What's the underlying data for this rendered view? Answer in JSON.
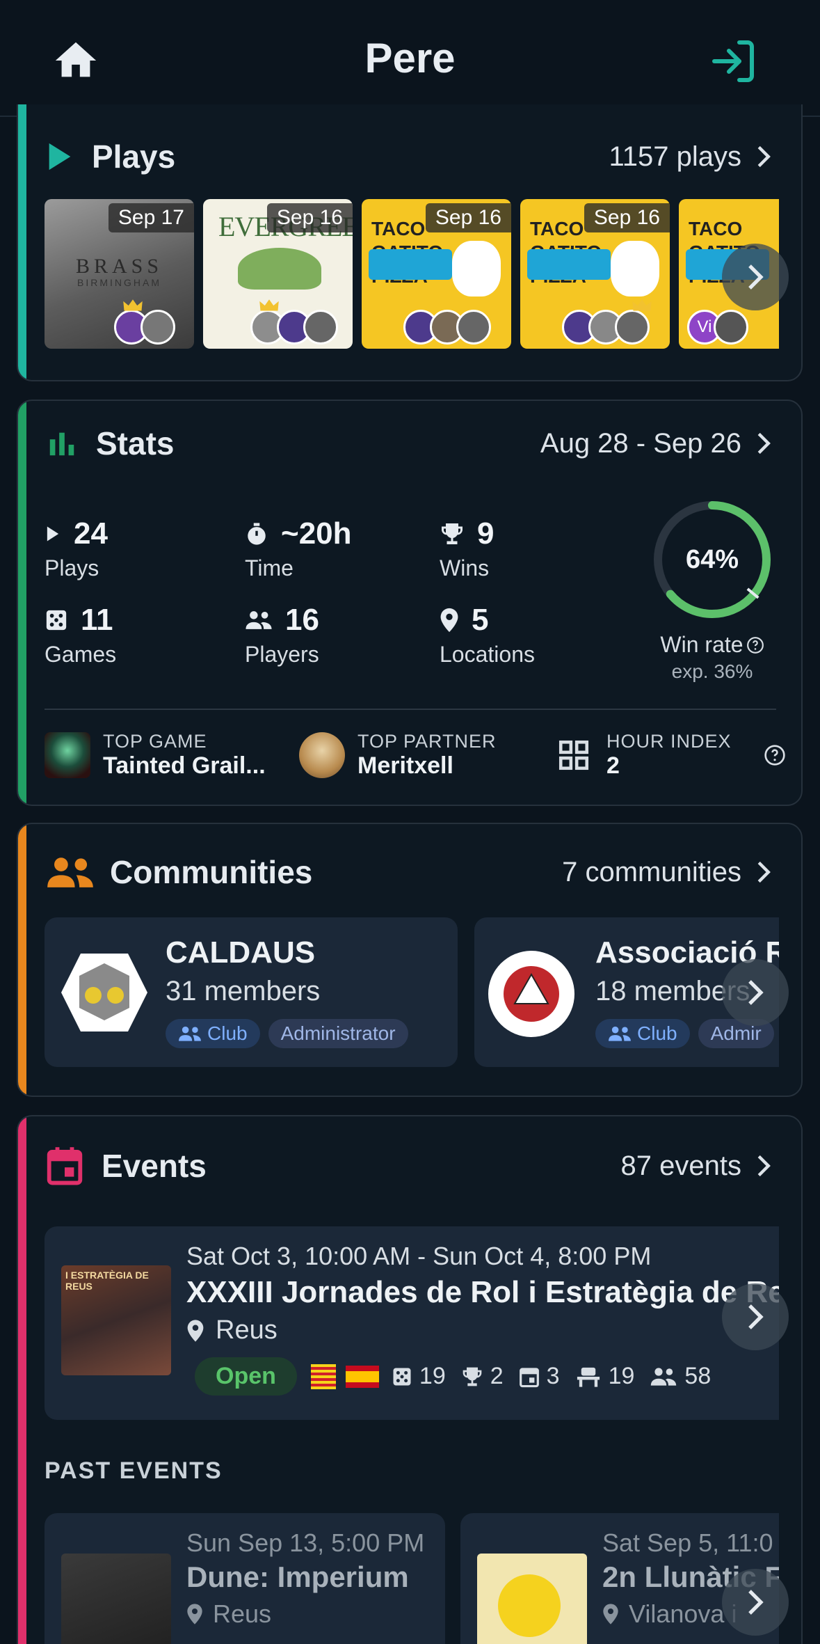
{
  "header": {
    "title": "Pere",
    "left_icon": "home-icon",
    "right_icon": "login-icon"
  },
  "plays": {
    "title": "Plays",
    "count_label": "1157 plays",
    "items": [
      {
        "date": "Sep 17",
        "game": "BRASS",
        "subtitle": "BIRMINGHAM"
      },
      {
        "date": "Sep 16",
        "game": "EVERGREEN"
      },
      {
        "date": "Sep 16",
        "game": "TACO GATITO PIZZA"
      },
      {
        "date": "Sep 16",
        "game": "TACO GATITO PIZZA"
      },
      {
        "date": "Se",
        "game": "TACO GATITO PIZZA",
        "avatar_initials": "Vi"
      }
    ]
  },
  "stats": {
    "title": "Stats",
    "range_label": "Aug 28 - Sep 26",
    "plays": {
      "value": "24",
      "label": "Plays"
    },
    "time": {
      "value": "~20h",
      "label": "Time"
    },
    "wins": {
      "value": "9",
      "label": "Wins"
    },
    "games": {
      "value": "11",
      "label": "Games"
    },
    "players": {
      "value": "16",
      "label": "Players"
    },
    "locations": {
      "value": "5",
      "label": "Locations"
    },
    "win_rate": {
      "percent_label": "64%",
      "fraction": 0.64,
      "expected_fraction": 0.36,
      "label": "Win rate",
      "expected_label": "exp. 36%"
    },
    "top_game": {
      "caption": "TOP GAME",
      "value": "Tainted Grail..."
    },
    "top_partner": {
      "caption": "TOP PARTNER",
      "value": "Meritxell"
    },
    "hour_index": {
      "caption": "HOUR INDEX",
      "value": "2"
    }
  },
  "communities": {
    "title": "Communities",
    "count_label": "7 communities",
    "items": [
      {
        "name": "CALDAUS",
        "members": "31 members",
        "badge_type": "Club",
        "badge_role": "Administrator"
      },
      {
        "name": "Associació R",
        "members": "18 members",
        "badge_type": "Club",
        "badge_role": "Admir"
      }
    ]
  },
  "events": {
    "title": "Events",
    "count_label": "87 events",
    "featured": {
      "datetime": "Sat Oct 3, 10:00 AM - Sun Oct 4, 8:00 PM",
      "name": "XXXIII Jornades de Rol i Estratègia de Reus",
      "location": "Reus",
      "status": "Open",
      "games": "19",
      "tournaments": "2",
      "days": "3",
      "tables": "19",
      "attendees": "58",
      "poster_text": "I ESTRATÈGIA DE REUS"
    },
    "past_title": "PAST EVENTS",
    "past": [
      {
        "datetime": "Sun Sep 13, 5:00 PM",
        "name": "Dune: Imperium",
        "location": "Reus"
      },
      {
        "datetime": "Sat Sep 5, 11:0",
        "name": "2n Llunàtic F",
        "location": "Vilanova i"
      }
    ]
  },
  "colors": {
    "plays_accent": "#1fb5a0",
    "stats_accent": "#21a065",
    "communities_accent": "#e8871e",
    "events_accent": "#e0306b",
    "win_ring": "#5cc06a",
    "open_badge_text": "#59c46a"
  }
}
